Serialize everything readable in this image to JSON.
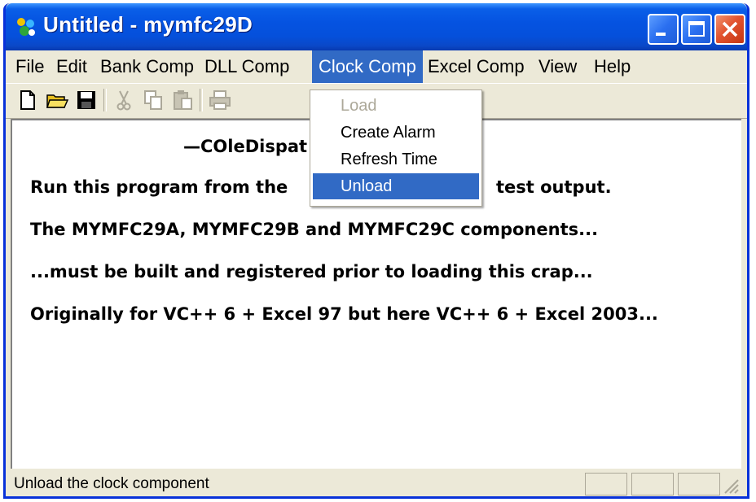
{
  "window": {
    "title": "Untitled - mymfc29D",
    "icon": "app-icon",
    "controls": [
      "minimize-icon",
      "maximize-icon",
      "close-icon"
    ]
  },
  "menubar": {
    "items": [
      {
        "label": "File"
      },
      {
        "label": "Edit"
      },
      {
        "label": "Bank Comp"
      },
      {
        "label": "DLL Comp"
      },
      {
        "label": "Clock Comp",
        "active": true
      },
      {
        "label": "Excel Comp"
      },
      {
        "label": "View"
      },
      {
        "label": "Help"
      }
    ]
  },
  "toolbar": {
    "buttons": [
      {
        "icon": "new-file-icon",
        "enabled": true
      },
      {
        "icon": "open-folder-icon",
        "enabled": true
      },
      {
        "icon": "save-icon",
        "enabled": true
      },
      {
        "icon": "cut-icon",
        "enabled": false
      },
      {
        "icon": "copy-icon",
        "enabled": false
      },
      {
        "icon": "paste-icon",
        "enabled": false
      },
      {
        "icon": "print-icon",
        "enabled": false
      }
    ]
  },
  "dropdown": {
    "menu": "Clock Comp",
    "items": [
      {
        "label": "Load",
        "enabled": false
      },
      {
        "label": "Create Alarm",
        "enabled": true
      },
      {
        "label": "Refresh Time",
        "enabled": true
      },
      {
        "label": "Unload",
        "enabled": true,
        "selected": true
      }
    ]
  },
  "client": {
    "lines": [
      "—COleDispat",
      "Run this program from the",
      "test output.",
      "The MYMFC29A, MYMFC29B and MYMFC29C components...",
      "...must be built and registered prior to loading this crap...",
      "Originally for VC++ 6 + Excel 97 but here VC++ 6 + Excel 2003..."
    ]
  },
  "statusbar": {
    "text": "Unload the clock component"
  },
  "colors": {
    "titlebar": "#0553e1",
    "menu_highlight": "#316ac5",
    "window_face": "#ece9d8"
  }
}
